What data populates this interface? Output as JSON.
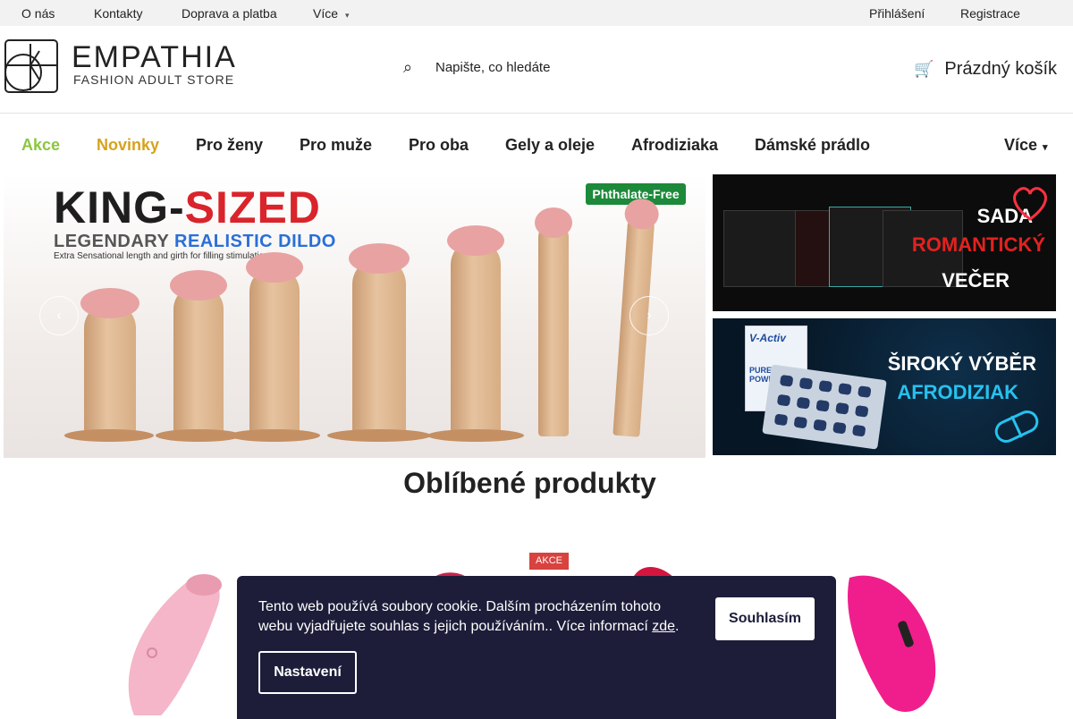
{
  "topbar": {
    "links": [
      "O nás",
      "Kontakty",
      "Doprava a platba",
      "Více"
    ],
    "login": "Přihlášení",
    "register": "Registrace"
  },
  "header": {
    "logo_name": "EMPATHIA",
    "logo_tagline": "FASHION ADULT STORE",
    "search_placeholder": "Napište, co hledáte",
    "cart_label": "Prázdný košík"
  },
  "nav": {
    "items": [
      "Akce",
      "Novinky",
      "Pro ženy",
      "Pro muže",
      "Pro oba",
      "Gely a oleje",
      "Afrodiziaka",
      "Dámské prádlo"
    ],
    "more": "Více",
    "colors": {
      "akce": "#8cc63f",
      "novinky": "#d6a21e"
    }
  },
  "banners": {
    "hero": {
      "title_part1": "KING-",
      "title_part2": "SIZED",
      "subtitle_part1": "LEGENDARY ",
      "subtitle_part2": "REALISTIC DILDO",
      "small": "Extra Sensational length and girth for filling stimulation",
      "badge": "Phthalate-Free"
    },
    "side1": {
      "line1": "SADA",
      "line2": "ROMANTICKÝ",
      "line3": "VEČER"
    },
    "side2": {
      "line1": "ŠIROKÝ VÝBĚR",
      "line2": "AFRODIZIAK",
      "product": "V-Activ",
      "tag": "PURE POWER"
    }
  },
  "section": {
    "title": "Oblíbené produkty"
  },
  "products": {
    "badge": "AKCE"
  },
  "cookie": {
    "text": "Tento web používá soubory cookie. Dalším procházením tohoto webu vyjadřujete souhlas s jejich používáním.. Více informací ",
    "link": "zde",
    "agree": "Souhlasím",
    "settings": "Nastavení"
  },
  "icons": {
    "search": "search-icon",
    "cart": "cart-icon",
    "caret": "chevron-down-icon",
    "prev": "arrow-left-icon",
    "next": "arrow-right-icon"
  }
}
